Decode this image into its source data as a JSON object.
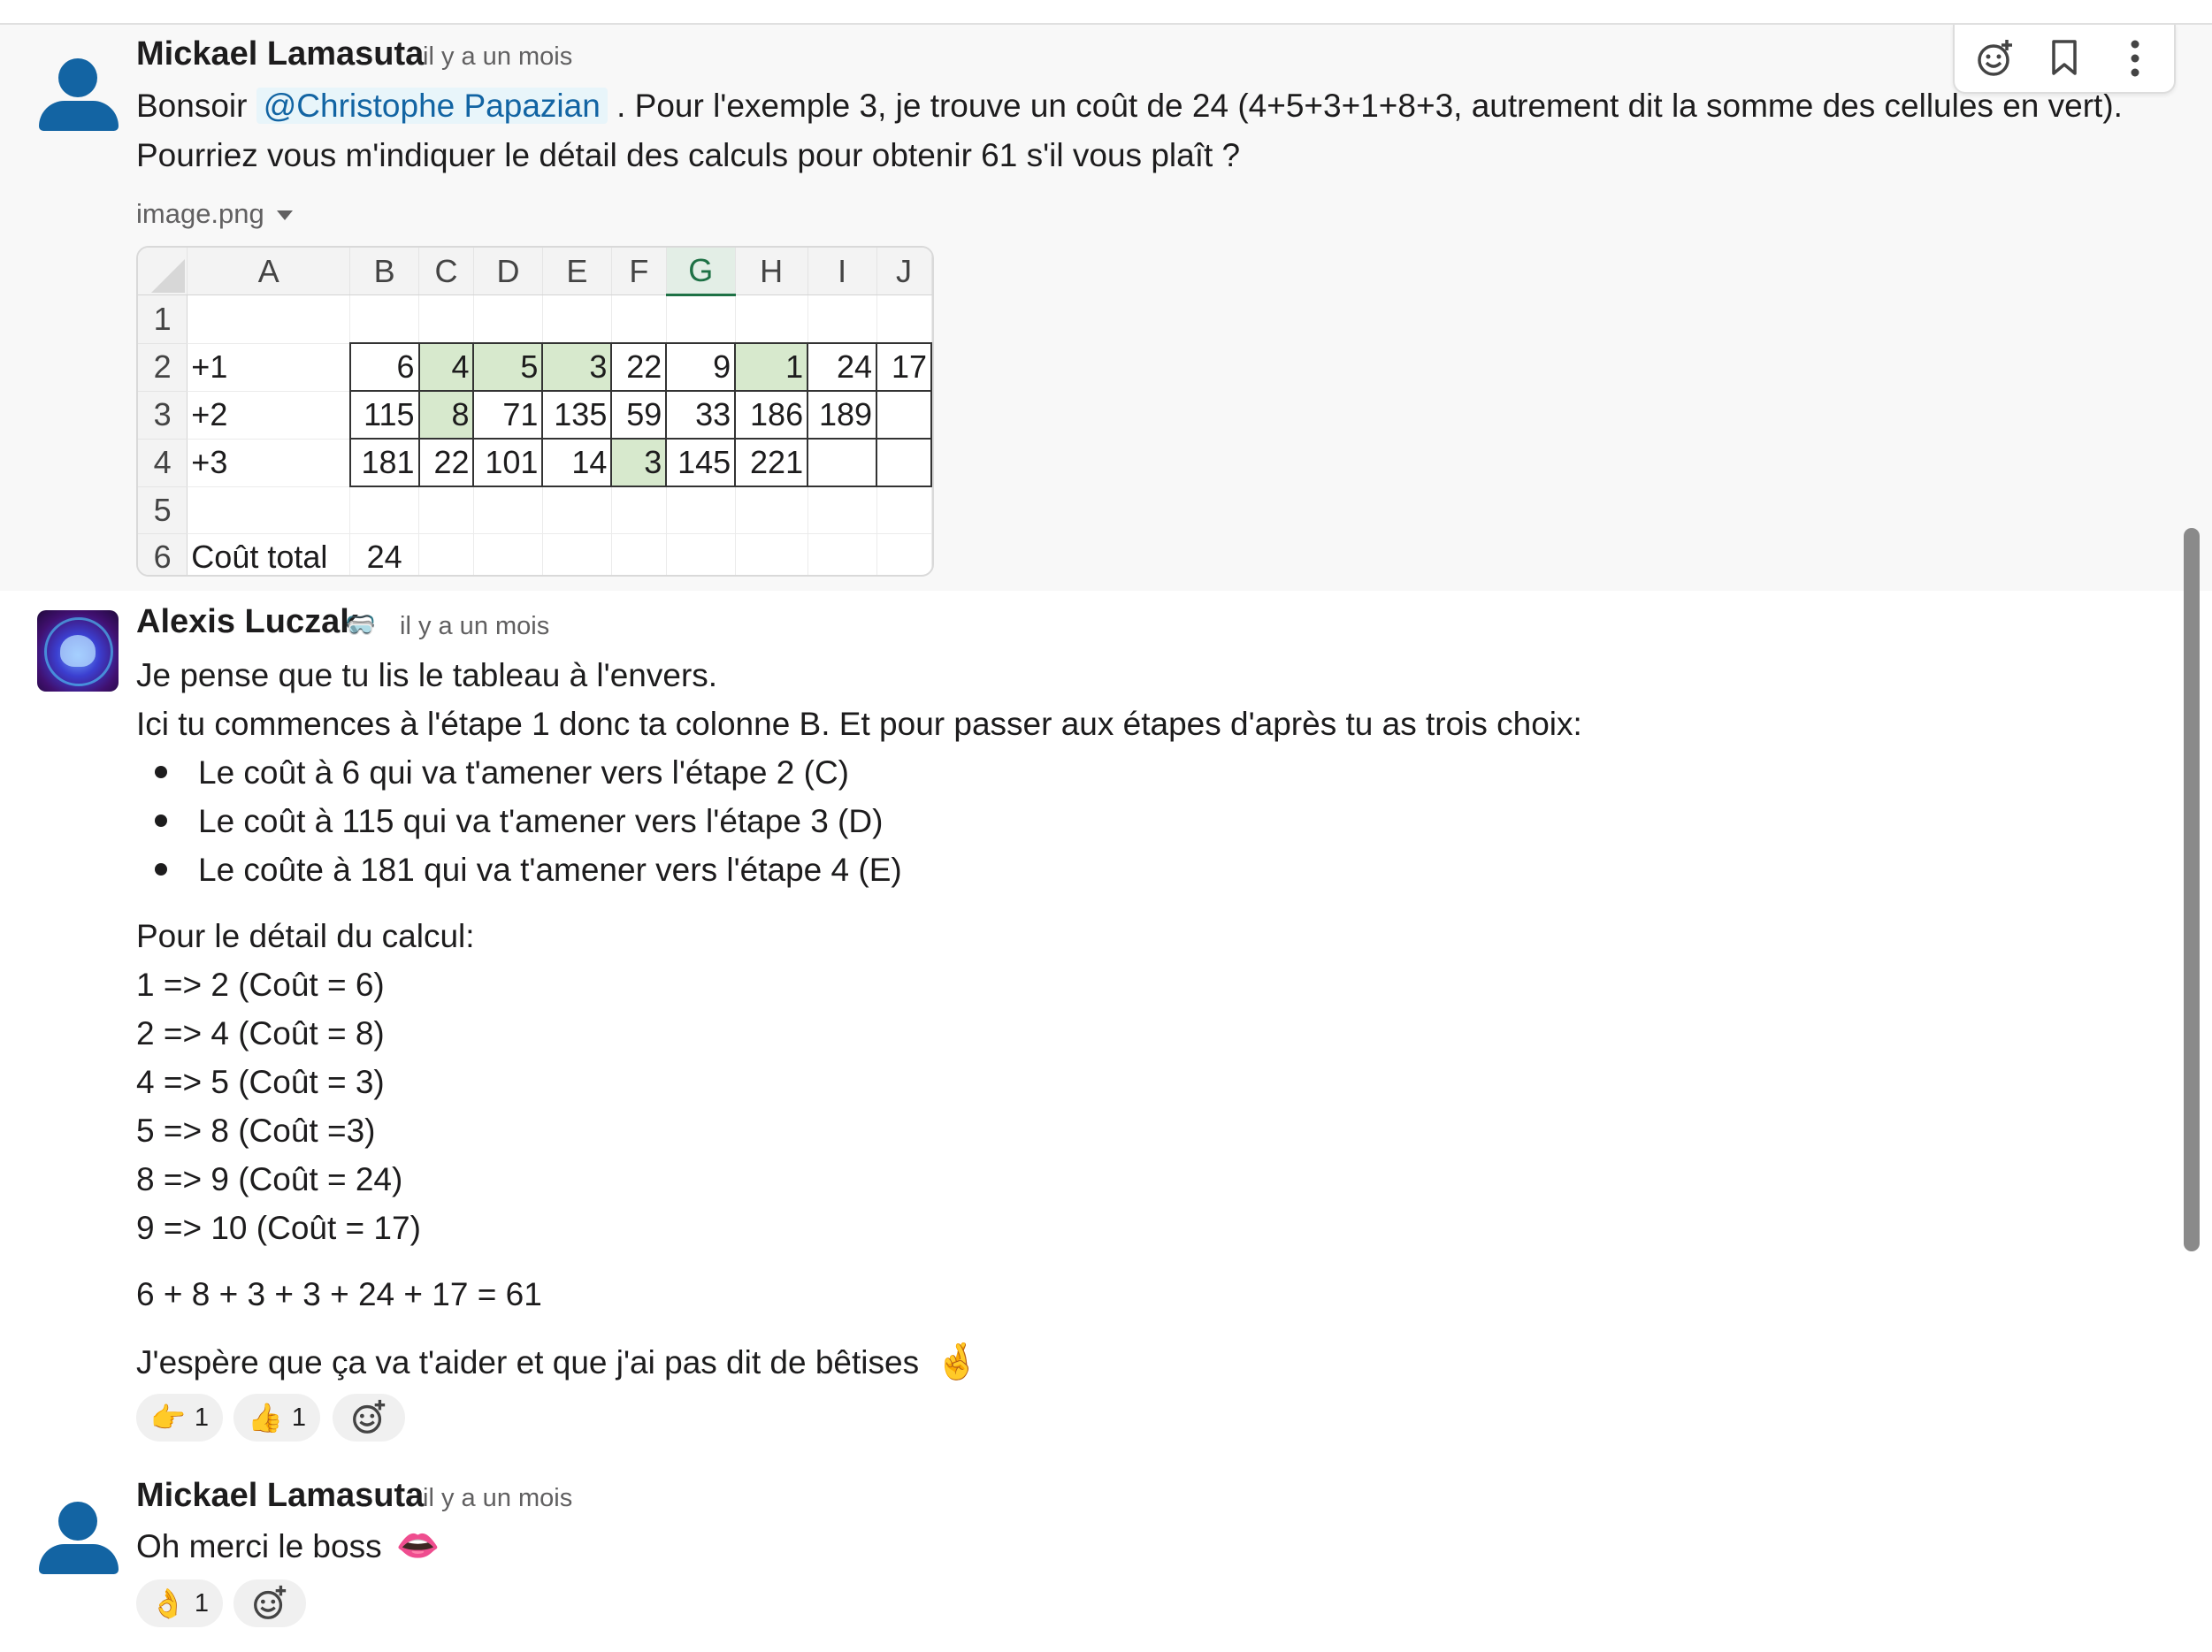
{
  "messages": [
    {
      "author": "Mickael Lamasuta",
      "time": "il y a un mois",
      "text_line1_prefix": "Bonsoir ",
      "mention": "@Christophe Papazian",
      "text_line1_suffix": " . Pour l'exemple 3, je trouve un coût de 24 (4+5+3+1+8+3, autrement dit la somme des cellules en vert).",
      "text_line2": "Pourriez vous m'indiquer le détail des calculs pour obtenir 61 s'il vous plaît ?",
      "attachment": {
        "filename": "image.png",
        "column_headers": [
          "A",
          "B",
          "C",
          "D",
          "E",
          "F",
          "G",
          "H",
          "I",
          "J"
        ],
        "rows": [
          {
            "n": "1",
            "label": "",
            "cells": [
              "",
              "",
              "",
              "",
              "",
              "",
              "",
              "",
              ""
            ]
          },
          {
            "n": "2",
            "label": "+1",
            "cells": [
              "6",
              "4",
              "5",
              "3",
              "22",
              "9",
              "1",
              "24",
              "17"
            ]
          },
          {
            "n": "3",
            "label": "+2",
            "cells": [
              "115",
              "8",
              "71",
              "135",
              "59",
              "33",
              "186",
              "189",
              ""
            ]
          },
          {
            "n": "4",
            "label": "+3",
            "cells": [
              "181",
              "22",
              "101",
              "14",
              "3",
              "145",
              "221",
              "",
              ""
            ]
          },
          {
            "n": "5",
            "label": "",
            "cells": [
              "",
              "",
              "",
              "",
              "",
              "",
              "",
              "",
              ""
            ]
          },
          {
            "n": "6",
            "label": "Coût total",
            "cells": [
              "24",
              "",
              "",
              "",
              "",
              "",
              "",
              "",
              ""
            ]
          }
        ],
        "highlight_color": "#d7e9cd"
      }
    },
    {
      "author": "Alexis Luczak",
      "time": "il y a un mois",
      "lines": [
        "Je pense que tu lis le tableau à l'envers.",
        "Ici tu commences à l'étape 1 donc ta colonne B. Et pour passer aux étapes d'après tu as trois choix:"
      ],
      "bullets": [
        "Le coût à 6 qui va t'amener vers l'étape 2 (C)",
        "Le coût à 115 qui va t'amener vers l'étape 3 (D)",
        "Le coûte à 181 qui va t'amener vers l'étape 4 (E)"
      ],
      "detail_title": "Pour le détail du calcul:",
      "steps": [
        "1 => 2 (Coût = 6)",
        "2 => 4 (Coût = 8)",
        "4 => 5 (Coût = 3)",
        "5 => 8 (Coût =3)",
        "8 => 9 (Coût = 24)",
        "9 => 10 (Coût = 17)"
      ],
      "sum": "6 + 8 + 3 + 3 + 24 + 17 = 61",
      "closing": "J'espère que ça va t'aider et que j'ai pas dit de bêtises",
      "reactions": [
        {
          "emoji": "👉",
          "count": "1"
        },
        {
          "emoji": "👍",
          "count": "1"
        }
      ]
    },
    {
      "author": "Mickael Lamasuta",
      "time": "il y a un mois",
      "text": "Oh merci le boss",
      "reactions": [
        {
          "emoji": "👌",
          "count": "1"
        }
      ]
    }
  ],
  "icons": {
    "reaction_add": "add-reaction-icon",
    "bookmark": "bookmark-icon",
    "more": "more-actions-icon",
    "crossed_fingers": "🤞",
    "lips": "👄",
    "badge": "🥽"
  },
  "colors": {
    "mention_text": "#1264a3",
    "mention_bg": "#e8f5fa",
    "avatar_blue": "#1364a3",
    "selected_column": "#1e7145"
  }
}
